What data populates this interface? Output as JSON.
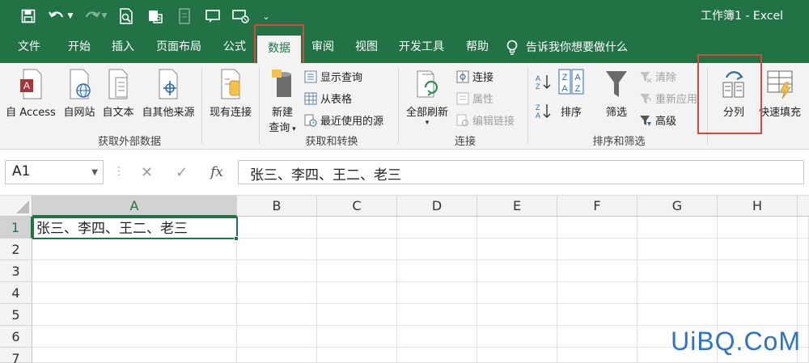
{
  "window": {
    "title": "工作簿1  -  Excel"
  },
  "qat": {
    "dropdown": "⌄"
  },
  "tabs": [
    {
      "label": "文件"
    },
    {
      "label": "开始"
    },
    {
      "label": "插入"
    },
    {
      "label": "页面布局"
    },
    {
      "label": "公式"
    },
    {
      "label": "数据"
    },
    {
      "label": "审阅"
    },
    {
      "label": "视图"
    },
    {
      "label": "开发工具"
    },
    {
      "label": "帮助"
    }
  ],
  "tell_me": {
    "label": "告诉我你想要做什么"
  },
  "ribbon": {
    "get_external": {
      "from_access": "自 Access",
      "from_web": "自网站",
      "from_text": "自文本",
      "from_other": "自其他来源",
      "existing": "现有连接",
      "label": "获取外部数据"
    },
    "get_transform": {
      "new_query_l1": "新建",
      "new_query_l2": "查询",
      "show_queries": "显示查询",
      "from_table": "从表格",
      "recent_sources": "最近使用的源",
      "label": "获取和转换"
    },
    "connections": {
      "refresh_all": "全部刷新",
      "connections": "连接",
      "properties": "属性",
      "edit_links": "编辑链接",
      "label": "连接"
    },
    "sort_filter": {
      "sort": "排序",
      "filter": "筛选",
      "clear": "清除",
      "reapply": "重新应用",
      "advanced": "高级",
      "label": "排序和筛选"
    },
    "data_tools": {
      "text_to_columns": "分列",
      "flash_fill": "快速填充"
    }
  },
  "formula_bar": {
    "name_box": "A1",
    "fx": "fx",
    "content": "张三、李四、王二、老三"
  },
  "grid": {
    "columns": [
      "A",
      "B",
      "C",
      "D",
      "E",
      "F",
      "G",
      "H"
    ],
    "rows": [
      "1",
      "2",
      "3",
      "4",
      "5",
      "6",
      "7"
    ],
    "a1": "张三、李四、王二、老三"
  },
  "watermark": "UiBQ.CoM",
  "colors": {
    "accent": "#217346",
    "highlight": "#d9473e"
  }
}
